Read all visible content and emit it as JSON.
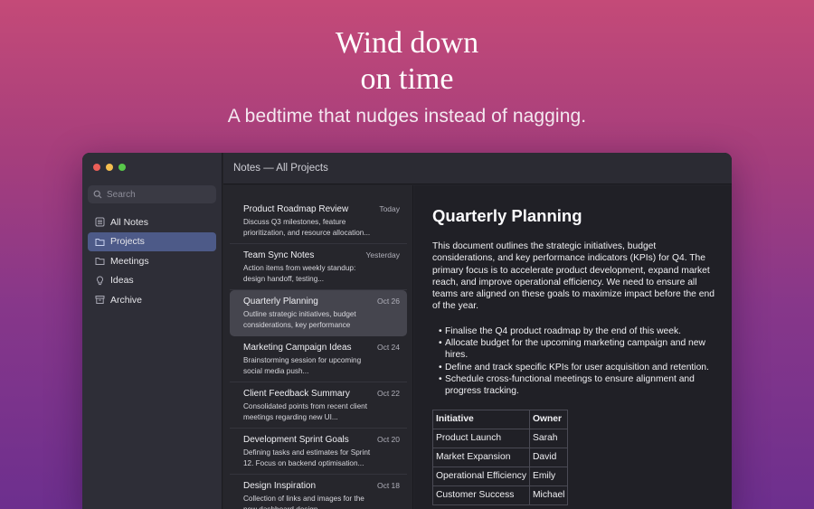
{
  "hero": {
    "title_line1": "Wind down",
    "title_line2": "on time",
    "subtitle": "A bedtime that nudges instead of nagging."
  },
  "window": {
    "title": "Notes — All Projects",
    "search_placeholder": "Search"
  },
  "sidebar": {
    "items": [
      {
        "label": "All Notes",
        "icon": "notes-list-icon",
        "active": false
      },
      {
        "label": "Projects",
        "icon": "folder-icon",
        "active": true
      },
      {
        "label": "Meetings",
        "icon": "folder-icon",
        "active": false
      },
      {
        "label": "Ideas",
        "icon": "lightbulb-icon",
        "active": false
      },
      {
        "label": "Archive",
        "icon": "archive-box-icon",
        "active": false
      }
    ]
  },
  "notes": [
    {
      "title": "Product Roadmap Review",
      "date": "Today",
      "preview": "Discuss Q3 milestones, feature prioritization, and resource allocation..."
    },
    {
      "title": "Team Sync Notes",
      "date": "Yesterday",
      "preview": "Action items from weekly standup: design handoff, testing..."
    },
    {
      "title": "Quarterly Planning",
      "date": "Oct 26",
      "preview": "Outline strategic initiatives, budget considerations, key performance indicators for",
      "active": true
    },
    {
      "title": "Marketing Campaign Ideas",
      "date": "Oct 24",
      "preview": "Brainstorming session for upcoming social media push..."
    },
    {
      "title": "Client Feedback Summary",
      "date": "Oct 22",
      "preview": "Consolidated points from recent client meetings regarding new UI..."
    },
    {
      "title": "Development Sprint Goals",
      "date": "Oct 20",
      "preview": "Defining tasks and estimates for Sprint 12. Focus on backend optimisation..."
    },
    {
      "title": "Design Inspiration",
      "date": "Oct 18",
      "preview": "Collection of links and images for the new dashboard design..."
    }
  ],
  "document": {
    "title": "Quarterly Planning",
    "body": "This document outlines the strategic initiatives, budget considerations, and key performance indicators (KPIs) for Q4. The primary focus is to accelerate product development, expand market reach, and improve operational efficiency. We need to ensure all teams are aligned on these goals to maximize impact before the end of the year.",
    "bullets": [
      "Finalise the Q4 product roadmap by the end of this week.",
      "Allocate budget for the upcoming marketing campaign and new hires.",
      "Define and track specific KPIs for user acquisition and retention.",
      "Schedule cross-functional meetings to ensure alignment and progress tracking."
    ],
    "table": {
      "headers": [
        "Initiative",
        "Owner"
      ],
      "rows": [
        [
          "Product Launch",
          "Sarah"
        ],
        [
          "Market Expansion",
          "David"
        ],
        [
          "Operational Efficiency",
          "Emily"
        ],
        [
          "Customer Success",
          "Michael"
        ]
      ]
    }
  },
  "colors": {
    "accent_active": "#4d5a88",
    "traffic_red": "#ec5f58",
    "traffic_yellow": "#f4be4f",
    "traffic_green": "#58c84a"
  }
}
